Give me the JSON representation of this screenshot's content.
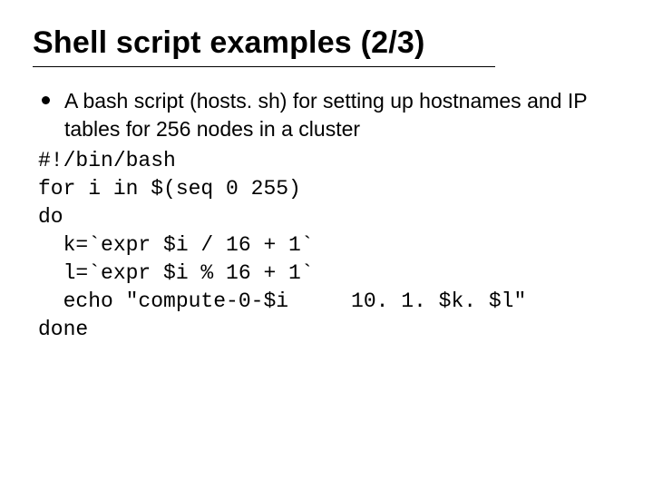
{
  "title": "Shell script examples (2/3)",
  "bullet": "A bash script (hosts. sh) for setting up hostnames and IP tables for 256 nodes in a cluster",
  "code": {
    "l1": "#!/bin/bash",
    "l2": "for i in $(seq 0 255)",
    "l3": "do",
    "l4": "  k=`expr $i / 16 + 1`",
    "l5": "  l=`expr $i % 16 + 1`",
    "l6": "  echo \"compute-0-$i     10. 1. $k. $l\"",
    "l7": "done"
  }
}
